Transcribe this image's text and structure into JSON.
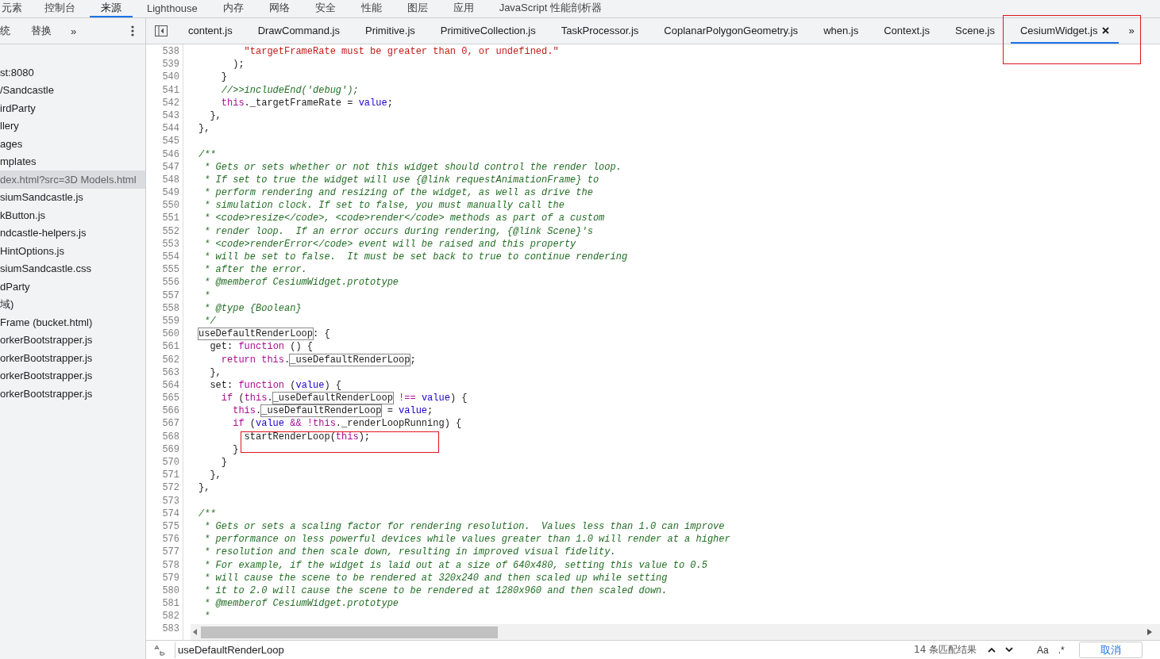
{
  "panel_tabs": [
    {
      "label": "元素",
      "selected": false
    },
    {
      "label": "控制台",
      "selected": false
    },
    {
      "label": "来源",
      "selected": true
    },
    {
      "label": "Lighthouse",
      "selected": false
    },
    {
      "label": "内存",
      "selected": false
    },
    {
      "label": "网络",
      "selected": false
    },
    {
      "label": "安全",
      "selected": false
    },
    {
      "label": "性能",
      "selected": false
    },
    {
      "label": "图层",
      "selected": false
    },
    {
      "label": "应用",
      "selected": false
    },
    {
      "label": "JavaScript 性能剖析器",
      "selected": false
    }
  ],
  "navigator": {
    "tabs": [
      "统",
      "替换"
    ],
    "more": "»",
    "items": [
      {
        "label": "st:8080",
        "selected": false
      },
      {
        "label": "/Sandcastle",
        "selected": false
      },
      {
        "label": "irdParty",
        "selected": false
      },
      {
        "label": "llery",
        "selected": false
      },
      {
        "label": "ages",
        "selected": false
      },
      {
        "label": "mplates",
        "selected": false
      },
      {
        "label": "dex.html?src=3D Models.html",
        "selected": true
      },
      {
        "label": "siumSandcastle.js",
        "selected": false
      },
      {
        "label": "kButton.js",
        "selected": false
      },
      {
        "label": "ndcastle-helpers.js",
        "selected": false
      },
      {
        "label": "HintOptions.js",
        "selected": false
      },
      {
        "label": "siumSandcastle.css",
        "selected": false
      },
      {
        "label": "dParty",
        "selected": false
      },
      {
        "label": "域)",
        "selected": false
      },
      {
        "label": "Frame (bucket.html)",
        "selected": false
      },
      {
        "label": "orkerBootstrapper.js",
        "selected": false
      },
      {
        "label": "orkerBootstrapper.js",
        "selected": false
      },
      {
        "label": "orkerBootstrapper.js",
        "selected": false
      },
      {
        "label": "orkerBootstrapper.js",
        "selected": false
      }
    ]
  },
  "editor_tabs": [
    {
      "label": "content.js",
      "selected": false,
      "closable": false,
      "annotated": false
    },
    {
      "label": "DrawCommand.js",
      "selected": false,
      "closable": false,
      "annotated": false
    },
    {
      "label": "Primitive.js",
      "selected": false,
      "closable": false,
      "annotated": false
    },
    {
      "label": "PrimitiveCollection.js",
      "selected": false,
      "closable": false,
      "annotated": false
    },
    {
      "label": "TaskProcessor.js",
      "selected": false,
      "closable": false,
      "annotated": false
    },
    {
      "label": "CoplanarPolygonGeometry.js",
      "selected": false,
      "closable": false,
      "annotated": false
    },
    {
      "label": "when.js",
      "selected": false,
      "closable": false,
      "annotated": false
    },
    {
      "label": "Context.js",
      "selected": false,
      "closable": false,
      "annotated": false
    },
    {
      "label": "Scene.js",
      "selected": false,
      "closable": false,
      "annotated": false
    },
    {
      "label": "CesiumWidget.js",
      "selected": true,
      "closable": true,
      "annotated": true
    }
  ],
  "editor_tabs_more": "»",
  "code_lines": [
    {
      "number": "538",
      "annotated": false,
      "tokens": [
        {
          "kind": "string",
          "text": "        \"targetFrameRate must be greater than 0, or undefined.\""
        }
      ]
    },
    {
      "number": "539",
      "annotated": false,
      "tokens": [
        {
          "kind": "plain",
          "text": "      );"
        }
      ]
    },
    {
      "number": "540",
      "annotated": false,
      "tokens": [
        {
          "kind": "plain",
          "text": "    }"
        }
      ]
    },
    {
      "number": "541",
      "annotated": false,
      "tokens": [
        {
          "kind": "comment",
          "text": "    //>>includeEnd('debug');"
        }
      ]
    },
    {
      "number": "542",
      "annotated": false,
      "tokens": [
        {
          "kind": "keyword",
          "text": "    this"
        },
        {
          "kind": "plain",
          "text": "._targetFrameRate = "
        },
        {
          "kind": "variable",
          "text": "value"
        },
        {
          "kind": "plain",
          "text": ";"
        }
      ]
    },
    {
      "number": "543",
      "annotated": false,
      "tokens": [
        {
          "kind": "plain",
          "text": "  },"
        }
      ]
    },
    {
      "number": "544",
      "annotated": false,
      "tokens": [
        {
          "kind": "plain",
          "text": "},"
        }
      ]
    },
    {
      "number": "545",
      "annotated": false
    },
    {
      "number": "546",
      "annotated": false,
      "tokens": [
        {
          "kind": "comment",
          "text": "/**"
        }
      ]
    },
    {
      "number": "547",
      "annotated": false,
      "tokens": [
        {
          "kind": "comment",
          "text": " * Gets or sets whether or not this widget should control the render loop."
        }
      ]
    },
    {
      "number": "548",
      "annotated": false,
      "tokens": [
        {
          "kind": "comment",
          "text": " * If set to true the widget will use {@link requestAnimationFrame} to"
        }
      ]
    },
    {
      "number": "549",
      "annotated": false,
      "tokens": [
        {
          "kind": "comment",
          "text": " * perform rendering and resizing of the widget, as well as drive the"
        }
      ]
    },
    {
      "number": "550",
      "annotated": false,
      "tokens": [
        {
          "kind": "comment",
          "text": " * simulation clock. If set to false, you must manually call the"
        }
      ]
    },
    {
      "number": "551",
      "annotated": false,
      "tokens": [
        {
          "kind": "comment",
          "text": " * <code>resize</code>, <code>render</code> methods as part of a custom"
        }
      ]
    },
    {
      "number": "552",
      "annotated": false,
      "tokens": [
        {
          "kind": "comment",
          "text": " * render loop.  If an error occurs during rendering, {@link Scene}'s"
        }
      ]
    },
    {
      "number": "553",
      "annotated": false,
      "tokens": [
        {
          "kind": "comment",
          "text": " * <code>renderError</code> event will be raised and this property"
        }
      ]
    },
    {
      "number": "554",
      "annotated": false,
      "tokens": [
        {
          "kind": "comment",
          "text": " * will be set to false.  It must be set back to true to continue rendering"
        }
      ]
    },
    {
      "number": "555",
      "annotated": false,
      "tokens": [
        {
          "kind": "comment",
          "text": " * after the error."
        }
      ]
    },
    {
      "number": "556",
      "annotated": false,
      "tokens": [
        {
          "kind": "comment",
          "text": " * @memberof CesiumWidget.prototype"
        }
      ]
    },
    {
      "number": "557",
      "annotated": false,
      "tokens": [
        {
          "kind": "comment",
          "text": " *"
        }
      ]
    },
    {
      "number": "558",
      "annotated": false,
      "tokens": [
        {
          "kind": "comment",
          "text": " * @type {Boolean}"
        }
      ]
    },
    {
      "number": "559",
      "annotated": false,
      "tokens": [
        {
          "kind": "comment",
          "text": " */"
        }
      ]
    },
    {
      "number": "560",
      "annotated": false,
      "tokens": [
        {
          "kind": "match",
          "text": "useDefaultRenderLoop"
        },
        {
          "kind": "plain",
          "text": ": {"
        }
      ]
    },
    {
      "number": "561",
      "annotated": false,
      "tokens": [
        {
          "kind": "plain",
          "text": "  get: "
        },
        {
          "kind": "keyword",
          "text": "function"
        },
        {
          "kind": "plain",
          "text": " () {"
        }
      ]
    },
    {
      "number": "562",
      "annotated": false,
      "tokens": [
        {
          "kind": "keyword",
          "text": "    return this"
        },
        {
          "kind": "plain",
          "text": "."
        },
        {
          "kind": "match",
          "text": "_useDefaultRenderLoop"
        },
        {
          "kind": "plain",
          "text": ";"
        }
      ]
    },
    {
      "number": "563",
      "annotated": false,
      "tokens": [
        {
          "kind": "plain",
          "text": "  },"
        }
      ]
    },
    {
      "number": "564",
      "annotated": false,
      "tokens": [
        {
          "kind": "plain",
          "text": "  set: "
        },
        {
          "kind": "keyword",
          "text": "function"
        },
        {
          "kind": "plain",
          "text": " ("
        },
        {
          "kind": "variable",
          "text": "value"
        },
        {
          "kind": "plain",
          "text": ") {"
        }
      ]
    },
    {
      "number": "565",
      "annotated": false,
      "tokens": [
        {
          "kind": "keyword",
          "text": "    if"
        },
        {
          "kind": "plain",
          "text": " ("
        },
        {
          "kind": "keyword",
          "text": "this"
        },
        {
          "kind": "plain",
          "text": "."
        },
        {
          "kind": "match",
          "text": "_useDefaultRenderLoop"
        },
        {
          "kind": "keyword",
          "text": " !== "
        },
        {
          "kind": "variable",
          "text": "value"
        },
        {
          "kind": "plain",
          "text": ") {"
        }
      ]
    },
    {
      "number": "566",
      "annotated": false,
      "tokens": [
        {
          "kind": "keyword",
          "text": "      this"
        },
        {
          "kind": "plain",
          "text": "."
        },
        {
          "kind": "match",
          "text": "_useDefaultRenderLoop"
        },
        {
          "kind": "plain",
          "text": " = "
        },
        {
          "kind": "variable",
          "text": "value"
        },
        {
          "kind": "plain",
          "text": ";"
        }
      ]
    },
    {
      "number": "567",
      "annotated": false,
      "tokens": [
        {
          "kind": "keyword",
          "text": "      if"
        },
        {
          "kind": "plain",
          "text": " ("
        },
        {
          "kind": "variable",
          "text": "value"
        },
        {
          "kind": "keyword",
          "text": " && !this"
        },
        {
          "kind": "plain",
          "text": "._renderLoopRunning) {"
        }
      ]
    },
    {
      "number": "568",
      "annotated": true,
      "tokens": [
        {
          "kind": "plain",
          "text": "        startRenderLoop("
        },
        {
          "kind": "keyword",
          "text": "this"
        },
        {
          "kind": "plain",
          "text": ");"
        }
      ]
    },
    {
      "number": "569",
      "annotated": false,
      "tokens": [
        {
          "kind": "plain",
          "text": "      }"
        }
      ]
    },
    {
      "number": "570",
      "annotated": false,
      "tokens": [
        {
          "kind": "plain",
          "text": "    }"
        }
      ]
    },
    {
      "number": "571",
      "annotated": false,
      "tokens": [
        {
          "kind": "plain",
          "text": "  },"
        }
      ]
    },
    {
      "number": "572",
      "annotated": false,
      "tokens": [
        {
          "kind": "plain",
          "text": "},"
        }
      ]
    },
    {
      "number": "573",
      "annotated": false
    },
    {
      "number": "574",
      "annotated": false,
      "tokens": [
        {
          "kind": "comment",
          "text": "/**"
        }
      ]
    },
    {
      "number": "575",
      "annotated": false,
      "tokens": [
        {
          "kind": "comment",
          "text": " * Gets or sets a scaling factor for rendering resolution.  Values less than 1.0 can improve"
        }
      ]
    },
    {
      "number": "576",
      "annotated": false,
      "tokens": [
        {
          "kind": "comment",
          "text": " * performance on less powerful devices while values greater than 1.0 will render at a higher"
        }
      ]
    },
    {
      "number": "577",
      "annotated": false,
      "tokens": [
        {
          "kind": "comment",
          "text": " * resolution and then scale down, resulting in improved visual fidelity."
        }
      ]
    },
    {
      "number": "578",
      "annotated": false,
      "tokens": [
        {
          "kind": "comment",
          "text": " * For example, if the widget is laid out at a size of 640x480, setting this value to 0.5"
        }
      ]
    },
    {
      "number": "579",
      "annotated": false,
      "tokens": [
        {
          "kind": "comment",
          "text": " * will cause the scene to be rendered at 320x240 and then scaled up while setting"
        }
      ]
    },
    {
      "number": "580",
      "annotated": false,
      "tokens": [
        {
          "kind": "comment",
          "text": " * it to 2.0 will cause the scene to be rendered at 1280x960 and then scaled down."
        }
      ]
    },
    {
      "number": "581",
      "annotated": false,
      "tokens": [
        {
          "kind": "comment",
          "text": " * @memberof CesiumWidget.prototype"
        }
      ]
    },
    {
      "number": "582",
      "annotated": false,
      "tokens": [
        {
          "kind": "comment",
          "text": " *"
        }
      ]
    },
    {
      "number": "583",
      "annotated": false
    }
  ],
  "search_bar": {
    "value": "useDefaultRenderLoop",
    "result_count": "14 条匹配结果",
    "match_case": "Aa",
    "regex": ".*",
    "cancel": "取消"
  }
}
